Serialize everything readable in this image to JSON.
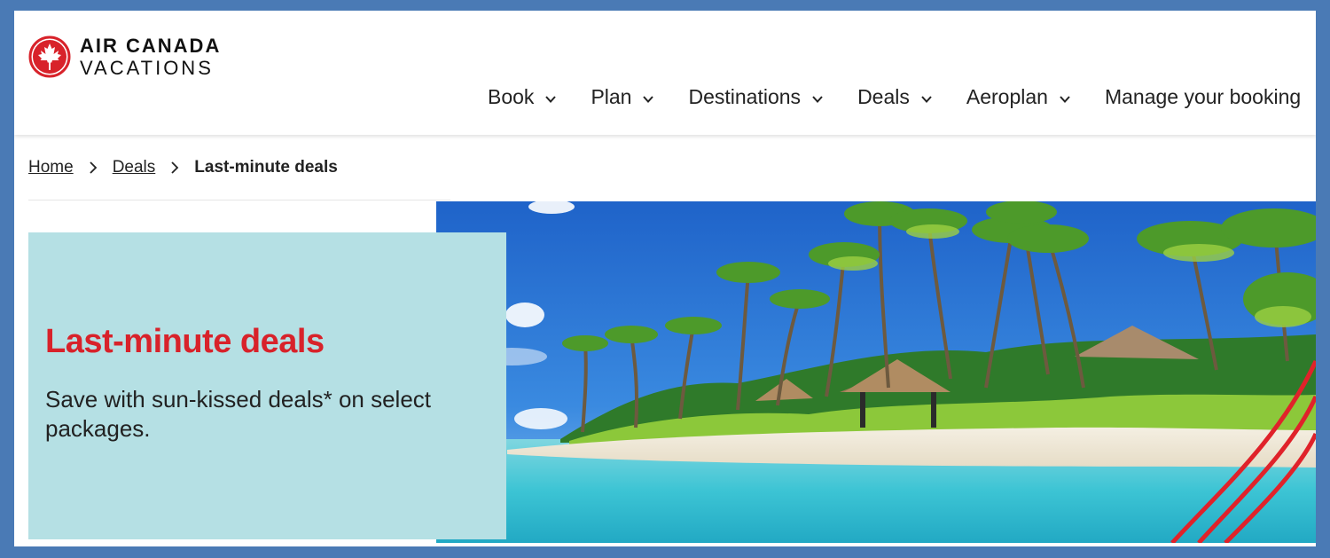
{
  "brand": {
    "line1": "AIR CANADA",
    "line2": "VACATIONS",
    "logo_icon": "maple-leaf-roundel-icon",
    "color": "#d8222a"
  },
  "nav": {
    "items": [
      {
        "label": "Book"
      },
      {
        "label": "Plan"
      },
      {
        "label": "Destinations"
      },
      {
        "label": "Deals"
      },
      {
        "label": "Aeroplan"
      },
      {
        "label": "Manage your booking"
      }
    ]
  },
  "breadcrumb": {
    "home": "Home",
    "deals": "Deals",
    "current": "Last-minute deals"
  },
  "hero": {
    "title": "Last-minute deals",
    "subtitle": "Save with sun-kissed deals* on select packages.",
    "card_color": "#b5e0e4",
    "image": "tropical-beach-palm-trees-image"
  },
  "colors": {
    "accent": "#d8222a",
    "frame_border": "#4a7ab5"
  }
}
